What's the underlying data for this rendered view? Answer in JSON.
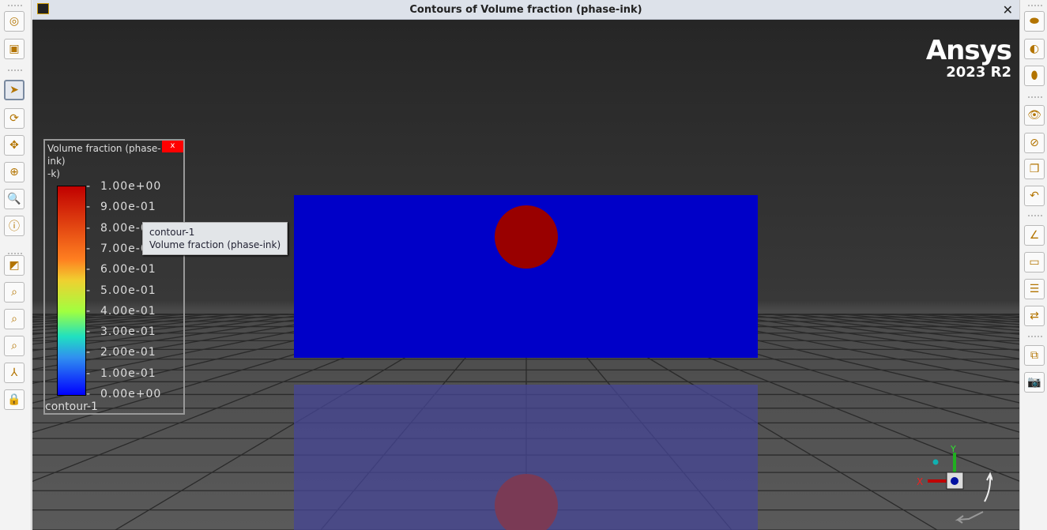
{
  "window": {
    "title": "Contours of Volume fraction (phase-ink)",
    "close": "✕"
  },
  "brand": {
    "name": "Ansys",
    "version": "2023 R2"
  },
  "left_toolbar": [
    {
      "name": "mesh-display-icon",
      "glyph": "◎"
    },
    {
      "name": "box-zoom-icon",
      "glyph": "▣"
    },
    {
      "name": "select-pointer-icon",
      "glyph": "➤"
    },
    {
      "name": "rotate-icon",
      "glyph": "⟳"
    },
    {
      "name": "pan-icon",
      "glyph": "✥"
    },
    {
      "name": "zoom-in-out-icon",
      "glyph": "⊕"
    },
    {
      "name": "zoom-to-area-icon",
      "glyph": "🔍"
    },
    {
      "name": "probe-info-icon",
      "glyph": "ⓘ"
    },
    {
      "name": "fit-to-window-icon",
      "glyph": "◩"
    },
    {
      "name": "zoom-fit-icon",
      "glyph": "⌕"
    },
    {
      "name": "zoom-in-icon",
      "glyph": "⌕"
    },
    {
      "name": "zoom-out-icon",
      "glyph": "⌕"
    },
    {
      "name": "axes-view-icon",
      "glyph": "⅄"
    },
    {
      "name": "lock-view-icon",
      "glyph": "🔒"
    }
  ],
  "right_toolbar": [
    {
      "name": "view-front-icon",
      "glyph": "⬬"
    },
    {
      "name": "view-side-icon",
      "glyph": "◐"
    },
    {
      "name": "view-iso-icon",
      "glyph": "⬮"
    },
    {
      "name": "show-icon",
      "glyph": "👁"
    },
    {
      "name": "hide-icon",
      "glyph": "⊘"
    },
    {
      "name": "copy-view-icon",
      "glyph": "❐"
    },
    {
      "name": "undo-view-icon",
      "glyph": "↶"
    },
    {
      "name": "axes-toggle-icon",
      "glyph": "∠"
    },
    {
      "name": "ruler-icon",
      "glyph": "▭"
    },
    {
      "name": "notes-icon",
      "glyph": "☰"
    },
    {
      "name": "legend-toggle-icon",
      "glyph": "⇄"
    },
    {
      "name": "duplicate-icon",
      "glyph": "⧉"
    },
    {
      "name": "snapshot-icon",
      "glyph": "📷"
    }
  ],
  "legend": {
    "title": "Volume fraction (phase-ink)",
    "title_wrap": "-k)",
    "close": "x",
    "name": "contour-1",
    "ticks": [
      "1.00e+00",
      "9.00e-01",
      "8.00e-01",
      "7.00e-01",
      "6.00e-01",
      "5.00e-01",
      "4.00e-01",
      "3.00e-01",
      "2.00e-01",
      "1.00e-01",
      "0.00e+00"
    ],
    "range": [
      0,
      1
    ]
  },
  "tooltip": {
    "line1": "contour-1",
    "line2": "Volume fraction (phase-ink)"
  },
  "triad": {
    "x": "X",
    "y": "Y"
  },
  "colors": {
    "domain": "#0000c8",
    "droplet": "#990000",
    "title_bar": "#dde2ea"
  }
}
